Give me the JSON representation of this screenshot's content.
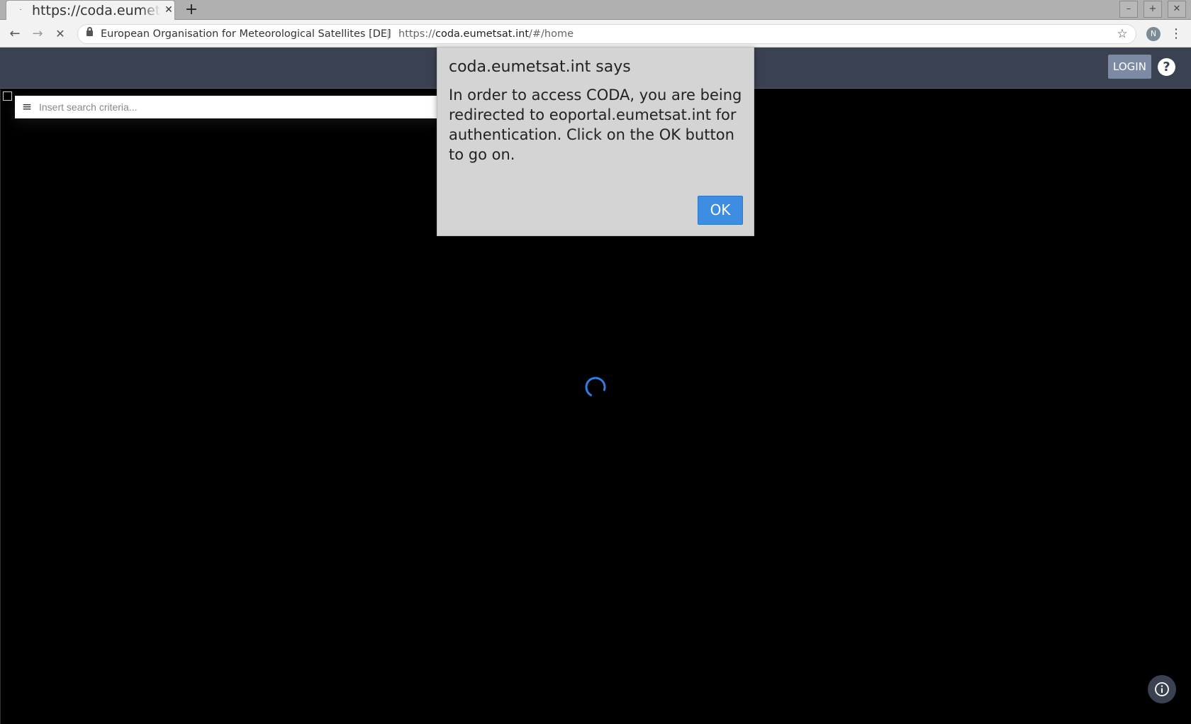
{
  "browser": {
    "tab": {
      "title": "https://coda.eumetsat.int/#/home",
      "loading_indicator": "·"
    },
    "new_tab_label": "+",
    "window_controls": {
      "minimize": "–",
      "maximize": "+",
      "close": "✕"
    },
    "nav": {
      "back": "←",
      "forward": "→",
      "stop": "✕"
    },
    "address_bar": {
      "site_name": "European Organisation for Meteorological Satellites [DE]",
      "url_scheme": "https://",
      "url_host": "coda.eumetsat.int",
      "url_path": "/#/home"
    },
    "bookmark_icon": "☆",
    "profile_initial": "N",
    "menu_icon": "⋮"
  },
  "app": {
    "header": {
      "login_label": "LOGIN",
      "help_label": "?"
    },
    "search": {
      "menu_icon": "≡",
      "placeholder": "Insert search criteria...",
      "value": ""
    }
  },
  "alert": {
    "title": "coda.eumetsat.int says",
    "message": "In order to access CODA, you are being redirected to eoportal.eumetsat.int for authentication. Click on the OK button to go on.",
    "ok_label": "OK"
  },
  "colors": {
    "header_bg": "#3a4150",
    "login_bg": "#7d8aa4",
    "ok_button": "#3d8ee2",
    "spinner": "#2f7fe0",
    "map_bg": "#000000"
  }
}
